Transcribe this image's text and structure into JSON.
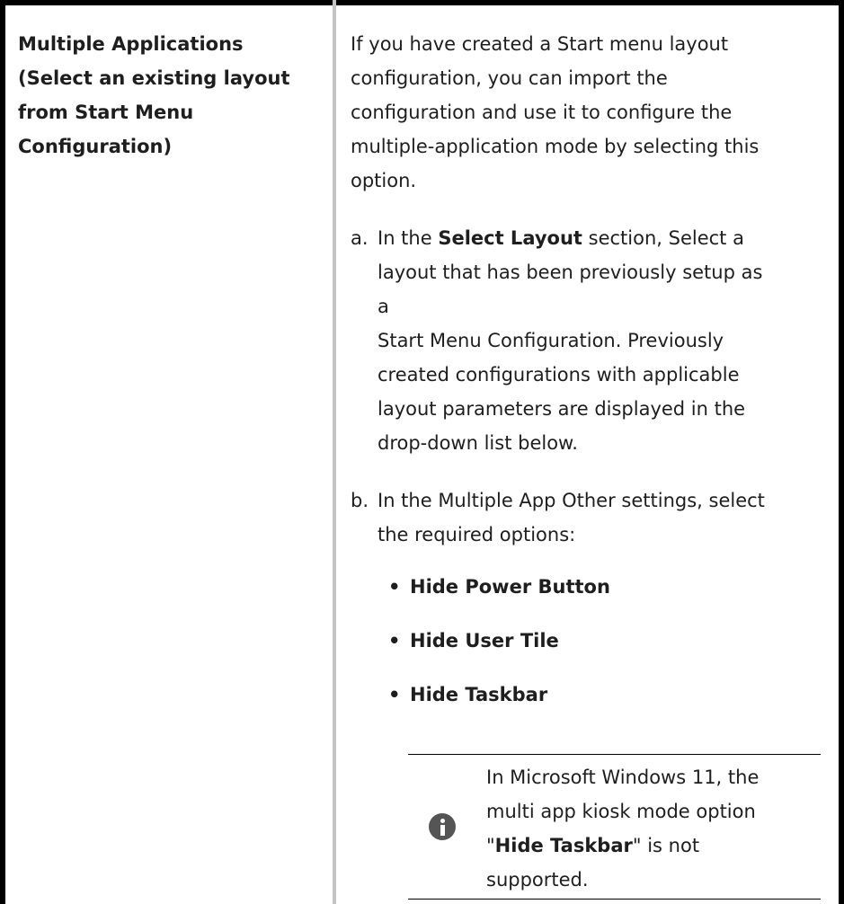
{
  "left": {
    "title_lines": [
      "Multiple Applications",
      "(Select an existing layout",
      "from Start Menu",
      "Configuration)"
    ]
  },
  "right": {
    "intro_lines": [
      "If you have created a Start menu layout",
      "configuration, you can import the",
      "configuration and use it to configure the",
      "multiple-application mode by selecting this",
      "option."
    ],
    "step_a": {
      "marker": "a.",
      "prefix": "In the ",
      "bold": "Select Layout",
      "suffix": " section, Select a",
      "lines": [
        "layout that has been previously setup as a",
        "Start Menu Configuration. Previously",
        "created configurations with applicable",
        "layout parameters are displayed in the",
        "drop-down list below."
      ]
    },
    "step_b": {
      "marker": "b.",
      "lines": [
        "In the Multiple App Other settings, select",
        "the required options:"
      ],
      "bullets": [
        "Hide Power Button",
        "Hide User Tile",
        "Hide Taskbar"
      ],
      "bullet_glyph": "•"
    },
    "note": {
      "icon": "info-icon",
      "line1": "In Microsoft Windows 11, the",
      "line2": "multi app kiosk mode option",
      "quote_open": "\"",
      "bold": "Hide Taskbar",
      "quote_close": "\"",
      "after": " is not",
      "line4": "supported."
    }
  }
}
